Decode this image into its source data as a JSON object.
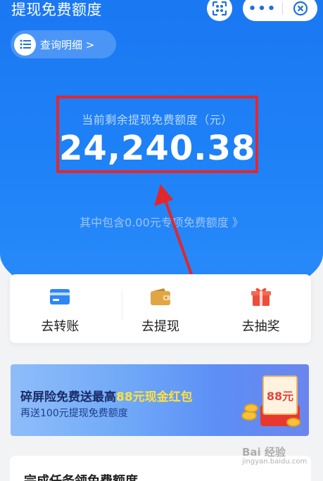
{
  "header": {
    "title": "提现免费额度"
  },
  "capsule": {
    "more_label": "•••"
  },
  "query": {
    "label": "查询明细 >"
  },
  "balance": {
    "label": "当前剩余提现免费额度（元）",
    "amount": "24,240.38"
  },
  "special": {
    "text": "其中包含0.00元专项免费额度 》"
  },
  "actions": [
    {
      "label": "去转账",
      "icon": "card-icon",
      "color": "#2f86f6"
    },
    {
      "label": "去提现",
      "icon": "wallet-icon",
      "color": "#e0a646"
    },
    {
      "label": "去抽奖",
      "icon": "gift-icon",
      "color": "#ee4d3c"
    }
  ],
  "banner": {
    "title_prefix": "碎屏险免费送最高",
    "title_highlight": "88元现金红包",
    "subtitle": "再送100元提现免费额度",
    "badge": "88元"
  },
  "task": {
    "title": "完成任务领免费额度"
  },
  "watermark": {
    "text": "Bai 经验",
    "sub": "jingyan.baidu.com"
  },
  "colors": {
    "primary": "#1f80f6",
    "highlight_box": "#e8262b",
    "arrow": "#e3262a"
  }
}
